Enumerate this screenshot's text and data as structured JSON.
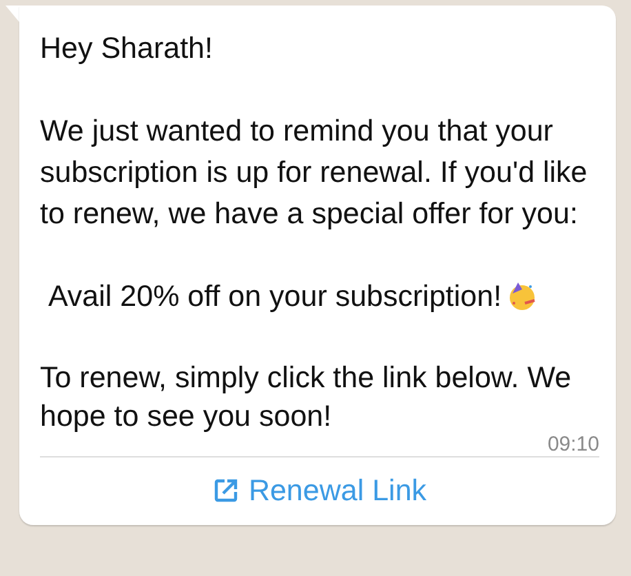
{
  "message": {
    "paragraphs": [
      {
        "kind": "text",
        "text": "Hey Sharath!"
      },
      {
        "kind": "text",
        "text": "We just wanted to remind you that your subscription is up for renewal. If you'd like to renew, we have a special offer for you:"
      },
      {
        "kind": "offer",
        "text": " Avail 20% off on your subscription!"
      },
      {
        "kind": "text",
        "text": "To renew, simply click the link below. We hope to see you soon!"
      }
    ],
    "time": "09:10",
    "button": {
      "label": "Renewal Link"
    }
  }
}
